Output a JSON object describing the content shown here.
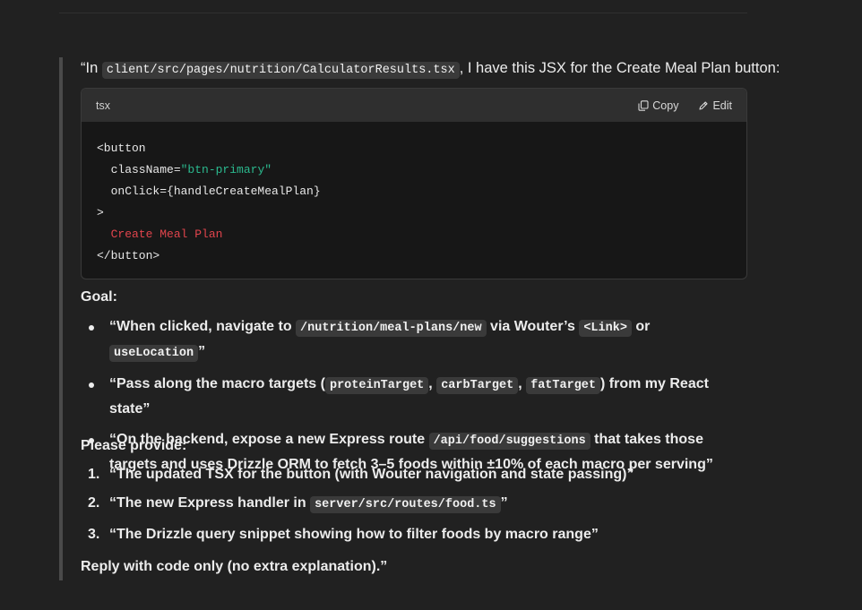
{
  "message": {
    "intro": {
      "prefix": "“In ",
      "path": "client/src/pages/nutrition/CalculatorResults.tsx",
      "suffix": ", I have this JSX for the Create Meal Plan button:"
    },
    "code_block": {
      "language": "tsx",
      "copy_label": "Copy",
      "edit_label": "Edit",
      "lines": {
        "l1": "<button",
        "l2_attr": "  className=",
        "l2_val": "\"btn-primary\"",
        "l3": "  onClick={handleCreateMealPlan}",
        "l4": ">",
        "l5": "  Create Meal Plan",
        "l6": "</button>"
      }
    },
    "goal_label": "Goal:",
    "goals": {
      "g1": {
        "t1": "“When clicked, navigate to ",
        "c1": "/nutrition/meal-plans/new",
        "t2": " via Wouter’s ",
        "c2": "<Link>",
        "t3": " or ",
        "c3": "useLocation",
        "t4": "”"
      },
      "g2": {
        "t1": "“Pass along the macro targets (",
        "c1": "proteinTarget",
        "t2": ", ",
        "c2": "carbTarget",
        "t3": ", ",
        "c3": "fatTarget",
        "t4": ") from my React state”"
      },
      "g3": {
        "t1": "“On the backend, expose a new Express route ",
        "c1": "/api/food/suggestions",
        "t2": " that takes those targets and uses Drizzle ORM to fetch 3–5 foods within ±10% of each macro per serving”"
      }
    },
    "provide_label": "Please provide:",
    "steps": {
      "s1": {
        "num": "1.",
        "text": "“The updated TSX for the button (with Wouter navigation and state passing)”"
      },
      "s2": {
        "num": "2.",
        "t1": "“The new Express handler in ",
        "c1": "server/src/routes/food.ts",
        "t2": "”"
      },
      "s3": {
        "num": "3.",
        "text": "“The Drizzle query snippet showing how to filter foods by macro range”"
      }
    },
    "closing": "Reply with code only (no extra explanation).”"
  },
  "colors": {
    "background": "#212121",
    "code_string": "#2bb98e",
    "code_text": "#e0444c"
  },
  "icons": {
    "copy": "copy-icon",
    "edit": "pencil-icon"
  }
}
